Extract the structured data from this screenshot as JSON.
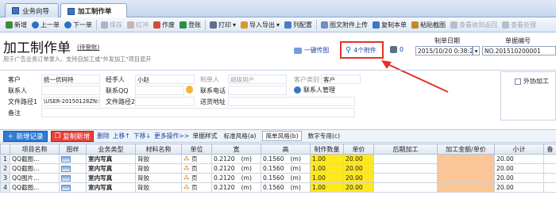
{
  "tabs": [
    {
      "label": "业务向导",
      "active": false
    },
    {
      "label": "加工制作单",
      "active": true
    }
  ],
  "toolbar": [
    {
      "label": "新增",
      "icon": "new-icon",
      "enabled": true
    },
    {
      "label": "上一单",
      "icon": "prev-icon",
      "enabled": true
    },
    {
      "label": "下一单",
      "icon": "next-icon",
      "enabled": true
    },
    {
      "label": "保存",
      "icon": "save-icon",
      "enabled": false
    },
    {
      "label": "红冲",
      "icon": "redflush-icon",
      "enabled": false
    },
    {
      "label": "作废",
      "icon": "void-icon",
      "enabled": true
    },
    {
      "label": "登账",
      "icon": "post-icon",
      "enabled": true
    },
    {
      "label": "打印",
      "icon": "print-icon",
      "enabled": true
    },
    {
      "label": "导入导出",
      "icon": "import-icon",
      "enabled": true
    },
    {
      "label": "列配置",
      "icon": "column-icon",
      "enabled": true
    },
    {
      "label": "图文附件上传",
      "icon": "upload-icon",
      "enabled": true
    },
    {
      "label": "复制本单",
      "icon": "copy-icon",
      "enabled": true
    },
    {
      "label": "粘贴截图",
      "icon": "paste-icon",
      "enabled": true
    },
    {
      "label": "查看收到返回",
      "icon": "view-icon",
      "enabled": false
    },
    {
      "label": "查看处理",
      "icon": "view2-icon",
      "enabled": false
    }
  ],
  "header": {
    "title": "加工制作单",
    "sublink": "(待登账)",
    "hint": "用于广告业务订单录入，支持自加工或\"外发加工\"项目混开",
    "upload_link": "一键传图",
    "attachments": "4个附件",
    "print_count": "0",
    "date_label": "制单日期",
    "date_value": "2015/10/20 0:38:29",
    "no_label": "单据编号",
    "no_value": "NO.201510200001"
  },
  "form": {
    "customer_label": "客户",
    "customer_value": "统一优码特",
    "handler_label": "经手人",
    "handler_value": "小赵",
    "maker_label": "制单人",
    "maker_value": "超级用户",
    "ctype_label": "客户类别",
    "ctype_value": "客户",
    "outsource_label": "外协加工",
    "contact_label": "联系人",
    "qq_label": "联系QQ",
    "phone_label": "联系电话",
    "contact_mgmt": "联系人管理",
    "path1_label": "文件路径1",
    "path1_value": "\\USER-20150128ZN:C:\\",
    "path2_label": "文件路径2",
    "ship_label": "送货地址",
    "note_label": "备注"
  },
  "gridbar": {
    "new_record": "新增记录",
    "copy_new": "复制新增",
    "delete": "删除",
    "up": "上移↑",
    "down": "下移↓",
    "more": "更多操作>>",
    "style": "单据样式",
    "tabs": [
      "标准风格(a)",
      "简单风格(b)",
      "数字专用(c)"
    ],
    "active_tab": 1
  },
  "columns": [
    "项目名称",
    "图样",
    "业务类型",
    "材料名称",
    "单位",
    "宽",
    "高",
    "制作数量",
    "单价",
    "后期加工",
    "加工金额/单价",
    "小计",
    "备"
  ],
  "rows": [
    {
      "num": "1",
      "name": "QQ截图...",
      "type": "室内写真",
      "material": "背胶",
      "unit": "页",
      "w": "0.2120",
      "wu": "(m)",
      "h": "0.1560",
      "hu": "(m)",
      "qty": "1.00",
      "price": "20.00",
      "amount": "20.00"
    },
    {
      "num": "2",
      "name": "QQ截图...",
      "type": "室内写真",
      "material": "背胶",
      "unit": "页",
      "w": "0.2120",
      "wu": "(m)",
      "h": "0.1560",
      "hu": "(m)",
      "qty": "1.00",
      "price": "20.00",
      "amount": "20.00"
    },
    {
      "num": "3",
      "name": "QQ图片...",
      "type": "室内写真",
      "material": "背胶",
      "unit": "页",
      "w": "0.2120",
      "wu": "(m)",
      "h": "0.1560",
      "hu": "(m)",
      "qty": "1.00",
      "price": "20.00",
      "amount": "20.00"
    },
    {
      "num": "4",
      "name": "QQ截图...",
      "type": "室内写真",
      "material": "背胶",
      "unit": "页",
      "w": "0.2120",
      "wu": "(m)",
      "h": "0.1560",
      "hu": "(m)",
      "qty": "1.00",
      "price": "20.00",
      "amount": "20.00"
    }
  ],
  "colors": {
    "accent": "#2f7ad6",
    "highlight_red": "#e53228",
    "qty_yellow": "#ffe81c",
    "amount_orange": "#fbc595"
  }
}
